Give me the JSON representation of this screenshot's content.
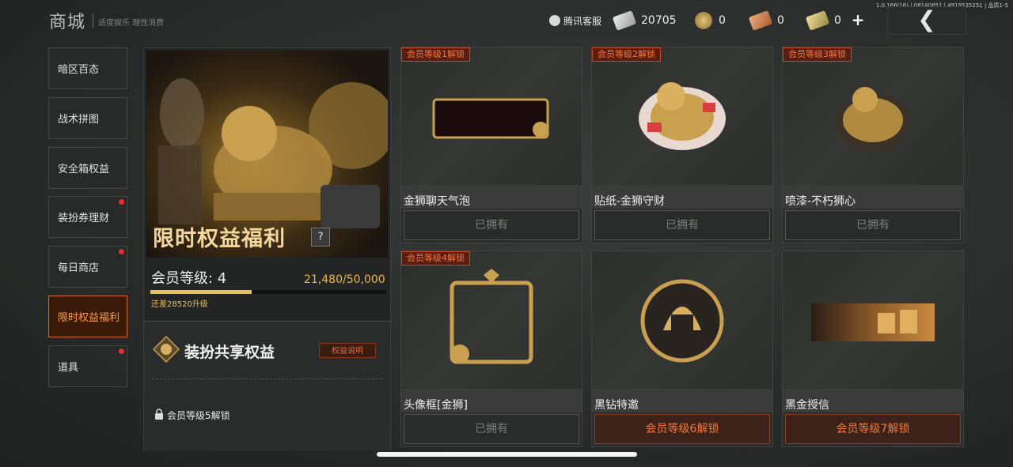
{
  "header": {
    "title": "商城",
    "subtitle": "适度娱乐 理性消费",
    "version": "1.0.166(16) | 08140851 | 4919535251 | 品质1-5",
    "customer_service": "腾讯客服",
    "currencies": [
      {
        "name": "ticket-currency",
        "value": "20705"
      },
      {
        "name": "coin-currency",
        "value": "0"
      },
      {
        "name": "coupon-currency",
        "value": "0"
      },
      {
        "name": "voucher-currency",
        "value": "0"
      }
    ],
    "add_label": "+",
    "back_label": "❮"
  },
  "sidebar": {
    "items": [
      {
        "label": "暗区百态",
        "dot": false
      },
      {
        "label": "战术拼图",
        "dot": false
      },
      {
        "label": "安全箱权益",
        "dot": false
      },
      {
        "label": "装扮券理财",
        "dot": true
      },
      {
        "label": "每日商店",
        "dot": true
      },
      {
        "label": "限时权益福利",
        "dot": false,
        "active": true
      },
      {
        "label": "道具",
        "dot": true
      }
    ]
  },
  "promo": {
    "title": "限时权益福利",
    "help": "?",
    "level_label": "会员等级: 4",
    "xp_text": "21,480/50,000",
    "xp_progress": 0.4296,
    "next_text": "还差28520升级",
    "share_title": "装扮共享权益",
    "share_button": "权益说明",
    "lock_text": "会员等级5解锁"
  },
  "cards": [
    {
      "tag": "会员等级1解锁",
      "name": "金狮聊天气泡",
      "button": "已拥有",
      "locked": false
    },
    {
      "tag": "会员等级2解锁",
      "name": "贴纸-金狮守财",
      "button": "已拥有",
      "locked": false
    },
    {
      "tag": "会员等级3解锁",
      "name": "喷漆-不朽狮心",
      "button": "已拥有",
      "locked": false
    },
    {
      "tag": "会员等级4解锁",
      "name": "头像框[金狮]",
      "button": "已拥有",
      "locked": false
    },
    {
      "tag": "",
      "name": "黑钻特邀",
      "button": "会员等级6解锁",
      "locked": true
    },
    {
      "tag": "",
      "name": "黑金授信",
      "button": "会员等级7解锁",
      "locked": true
    }
  ]
}
